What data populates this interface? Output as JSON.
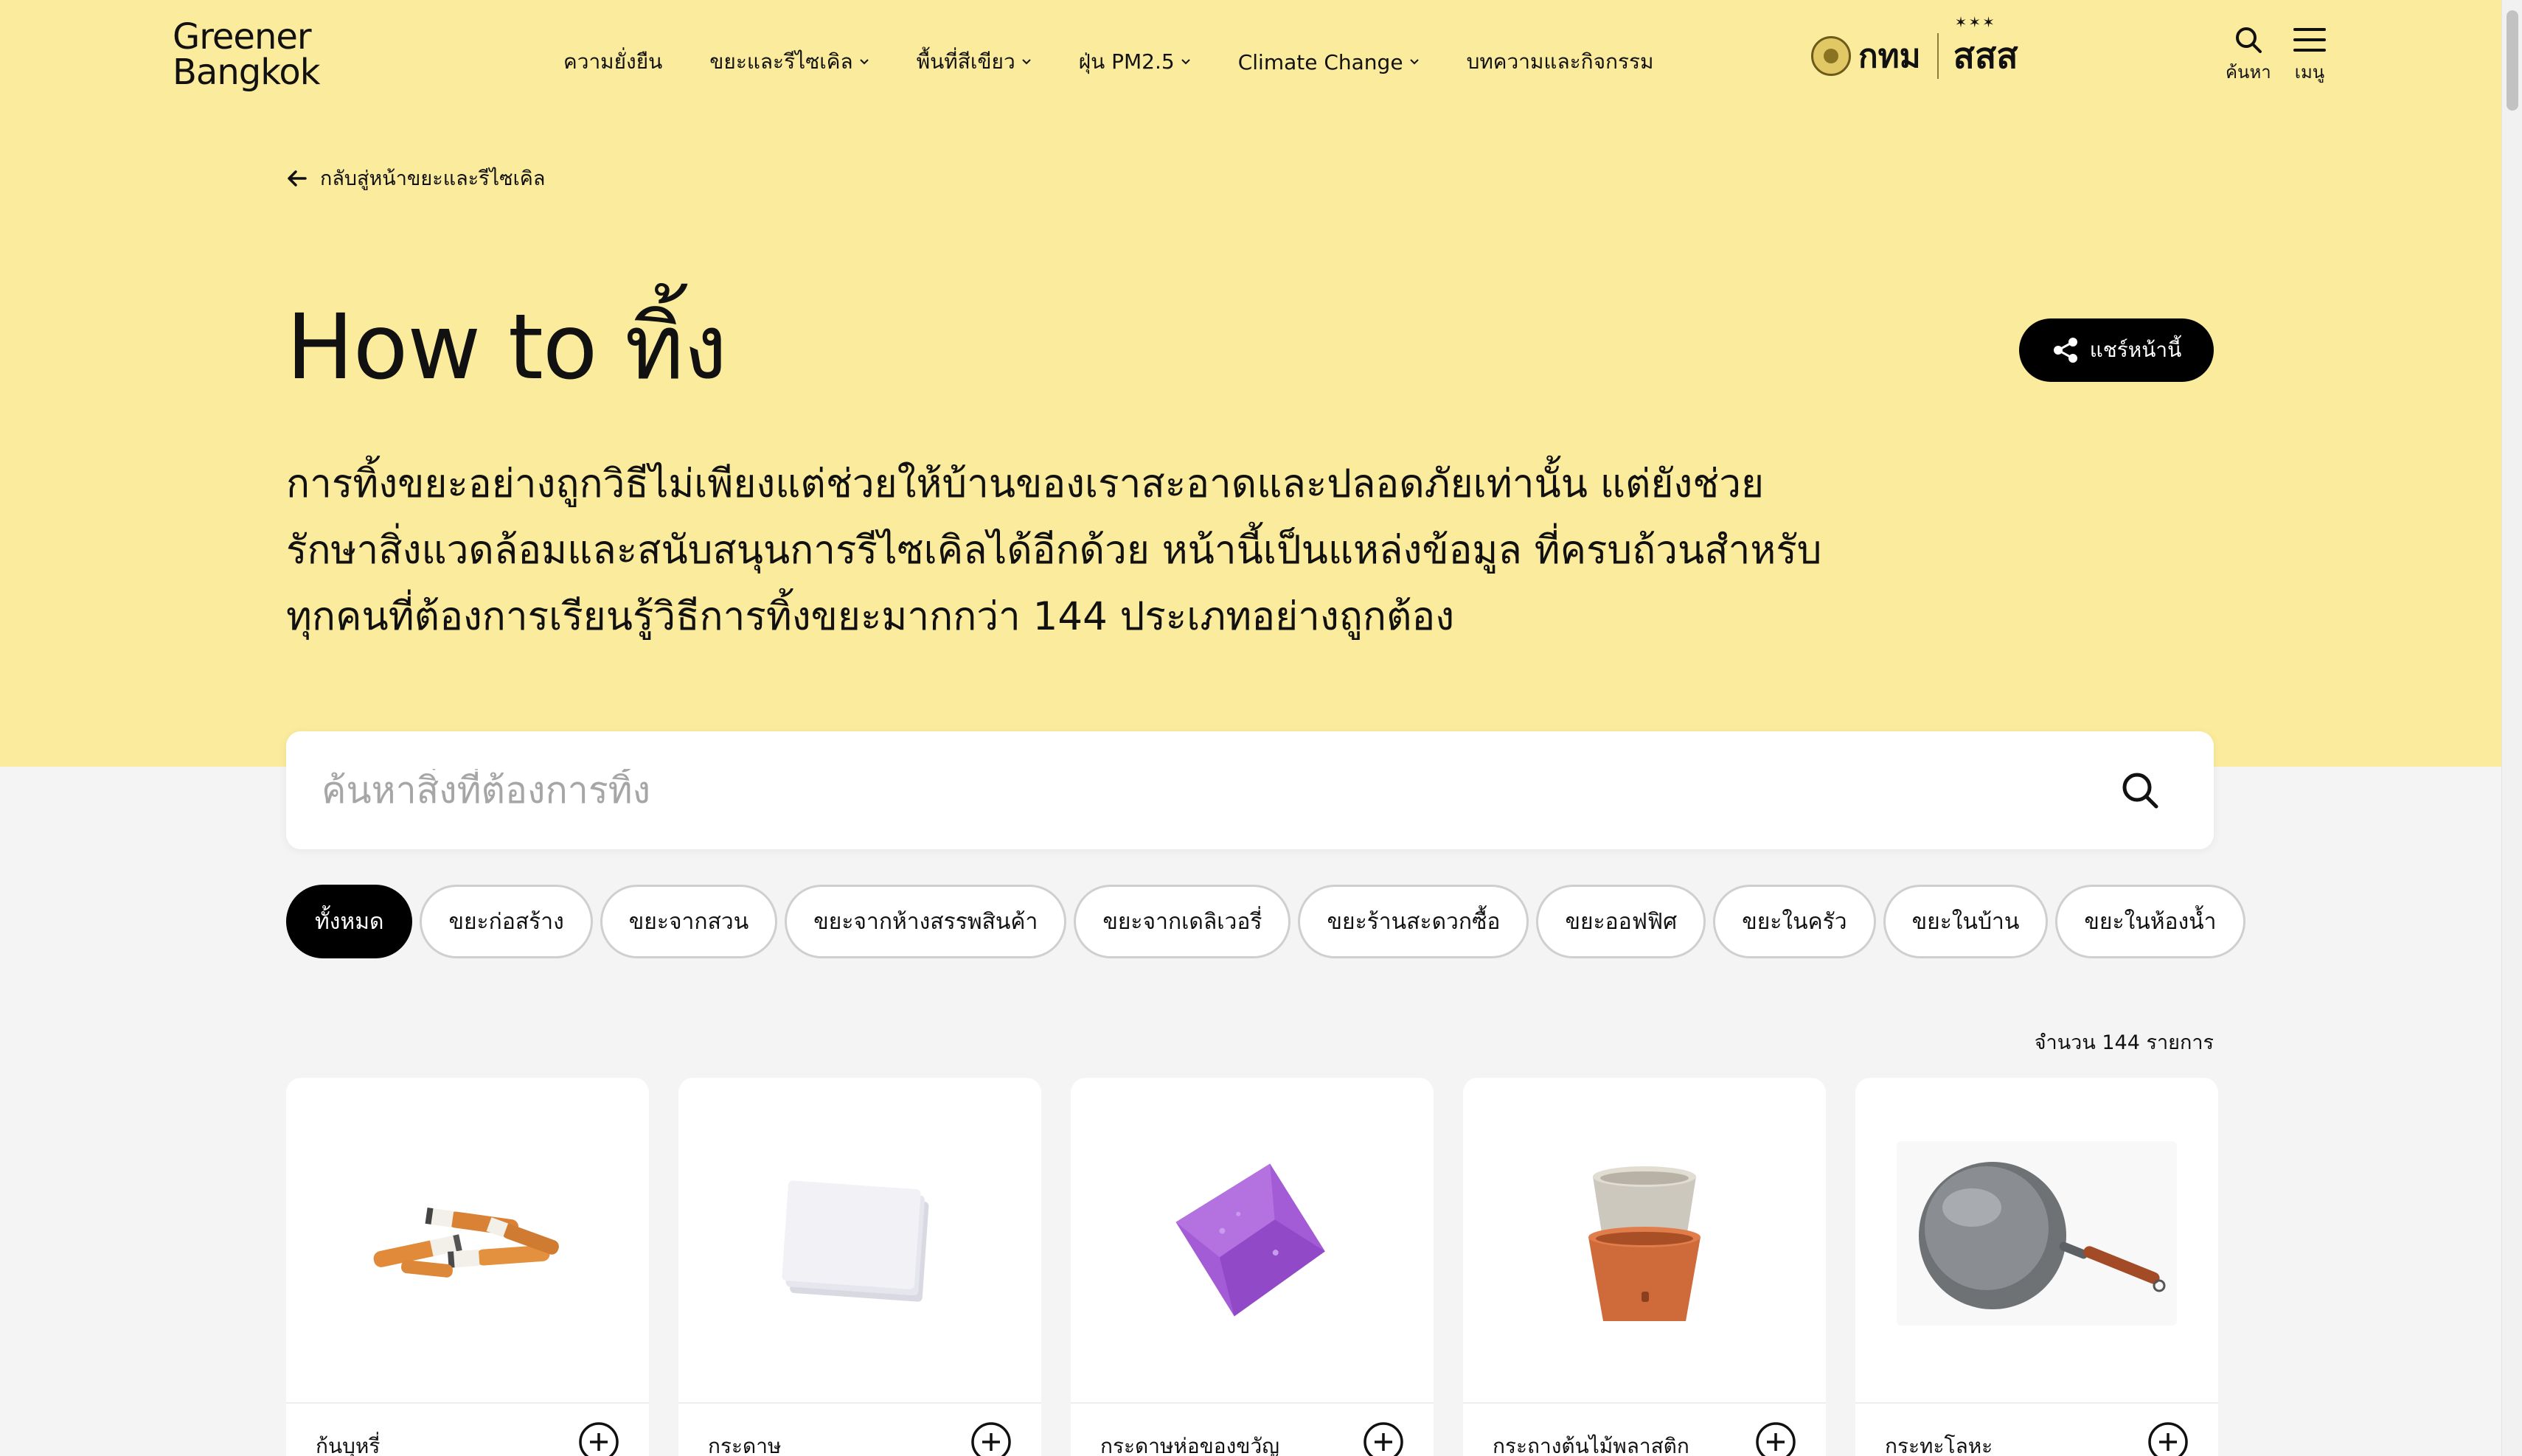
{
  "header": {
    "logo_line1": "Greener",
    "logo_line2": "Bangkok",
    "nav": [
      {
        "label": "ความยั่งยืน",
        "dropdown": false
      },
      {
        "label": "ขยะและรีไซเคิล",
        "dropdown": true
      },
      {
        "label": "พื้นที่สีเขียว",
        "dropdown": true
      },
      {
        "label": "ฝุ่น PM2.5",
        "dropdown": true
      },
      {
        "label": "Climate Change",
        "dropdown": true
      },
      {
        "label": "บทความและกิจกรรม",
        "dropdown": false
      }
    ],
    "partner_bma": "กทม",
    "partner_thaihealth": "สสส",
    "search_label": "ค้นหา",
    "menu_label": "เมนู"
  },
  "hero": {
    "back_link": "กลับสู่หน้าขยะและรีไซเคิล",
    "title": "How to ทิ้ง",
    "share_label": "แชร์หน้านี้",
    "intro_line1": "การทิ้งขยะอย่างถูกวิธีไม่เพียงแต่ช่วยให้บ้านของเราสะอาดและปลอดภัยเท่านั้น แต่ยังช่วย",
    "intro_line2": "รักษาสิ่งแวดล้อมและสนับสนุนการรีไซเคิลได้อีกด้วย หน้านี้เป็นแหล่งข้อมูล ที่ครบถ้วนสำหรับ",
    "intro_line3": "ทุกคนที่ต้องการเรียนรู้วิธีการทิ้งขยะมากกว่า 144 ประเภทอย่างถูกต้อง"
  },
  "search": {
    "placeholder": "ค้นหาสิ่งที่ต้องการทิ้ง",
    "value": ""
  },
  "filters": [
    "ทั้งหมด",
    "ขยะก่อสร้าง",
    "ขยะจากสวน",
    "ขยะจากห้างสรรพสินค้า",
    "ขยะจากเดลิเวอรี่",
    "ขยะร้านสะดวกซื้อ",
    "ขยะออฟฟิศ",
    "ขยะในครัว",
    "ขยะในบ้าน",
    "ขยะในห้องน้ำ"
  ],
  "active_filter": "ทั้งหมด",
  "count_label": "จำนวน 144 รายการ",
  "items": [
    {
      "label": "ก้นบุหรี่",
      "icon": "cigarette-butts-image"
    },
    {
      "label": "กระดาษ",
      "icon": "paper-stack-image"
    },
    {
      "label": "กระดาษห่อของขวัญ",
      "icon": "gift-wrap-paper-image"
    },
    {
      "label": "กระถางต้นไม้พลาสติก",
      "icon": "plastic-flower-pot-image"
    },
    {
      "label": "กระทะโลหะ",
      "icon": "metal-wok-image"
    }
  ],
  "colors": {
    "hero_bg": "#fbeb9c",
    "page_bg": "#f4f4f4",
    "accent_black": "#000000"
  }
}
